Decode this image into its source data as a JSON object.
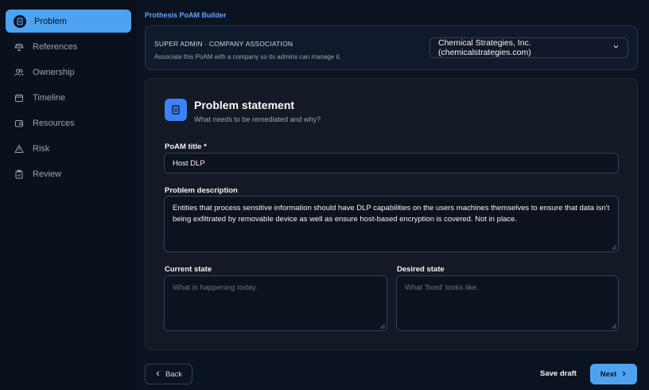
{
  "sidebar": {
    "items": [
      {
        "label": "Problem",
        "icon": "document-icon",
        "active": true
      },
      {
        "label": "References",
        "icon": "scale-icon"
      },
      {
        "label": "Ownership",
        "icon": "users-icon"
      },
      {
        "label": "Timeline",
        "icon": "calendar-icon"
      },
      {
        "label": "Resources",
        "icon": "wallet-icon"
      },
      {
        "label": "Risk",
        "icon": "warning-icon"
      },
      {
        "label": "Review",
        "icon": "clipboard-icon"
      }
    ]
  },
  "breadcrumb": "Prothesis PoAM Builder",
  "association": {
    "title": "SUPER ADMIN · COMPANY ASSOCIATION",
    "subtitle": "Associate this PoAM with a company so its admins can manage it.",
    "selected_company": "Chemical Strategies, Inc. (chemicalstrategies.com)"
  },
  "problem": {
    "title": "Problem statement",
    "subtitle": "What needs to be remediated and why?",
    "poam_title_label": "PoAM title *",
    "poam_title_value": "Host DLP",
    "description_label": "Problem description",
    "description_value": "Entities that process sensitive information should have DLP capabilities on the users machines themselves to ensure that data isn't being exfiltrated by removable device as well as ensure host-based encryption is covered. Not in place.",
    "current_state_label": "Current state",
    "current_state_placeholder": "What is happening today.",
    "desired_state_label": "Desired state",
    "desired_state_placeholder": "What 'fixed' looks like."
  },
  "footer": {
    "back_label": "Back",
    "save_draft_label": "Save draft",
    "next_label": "Next"
  },
  "colors": {
    "accent": "#4da3f0",
    "background": "#0b1220",
    "card": "#131a26"
  }
}
